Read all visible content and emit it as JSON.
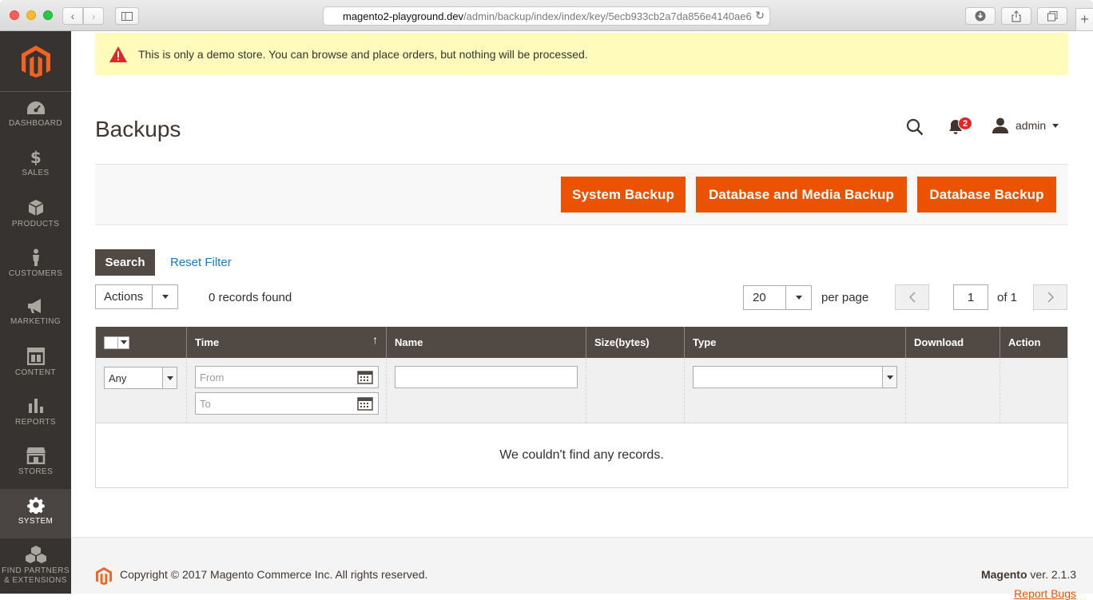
{
  "browser": {
    "url_domain": "magento2-playground.dev",
    "url_path": "/admin/backup/index/index/key/5ecb933cb2a7da856e4140ae6"
  },
  "sidebar": {
    "items": [
      {
        "label": "DASHBOARD",
        "icon": "dashboard-icon"
      },
      {
        "label": "SALES",
        "icon": "dollar-icon"
      },
      {
        "label": "PRODUCTS",
        "icon": "box-icon"
      },
      {
        "label": "CUSTOMERS",
        "icon": "person-icon"
      },
      {
        "label": "MARKETING",
        "icon": "megaphone-icon"
      },
      {
        "label": "CONTENT",
        "icon": "layout-icon"
      },
      {
        "label": "REPORTS",
        "icon": "bar-chart-icon"
      },
      {
        "label": "STORES",
        "icon": "storefront-icon"
      },
      {
        "label": "SYSTEM",
        "icon": "gear-icon"
      },
      {
        "label1": "FIND PARTNERS",
        "label2": "& EXTENSIONS",
        "icon": "cubes-icon"
      }
    ]
  },
  "demo_notice": "This is only a demo store. You can browse and place orders, but nothing will be processed.",
  "page_title": "Backups",
  "header": {
    "notification_count": "2",
    "user": "admin"
  },
  "buttons": {
    "system_backup": "System Backup",
    "db_media_backup": "Database and Media Backup",
    "db_backup": "Database Backup",
    "search": "Search",
    "reset_filter": "Reset Filter"
  },
  "toolbar": {
    "actions": "Actions",
    "records_found": "0 records found",
    "per_page_value": "20",
    "per_page_label": "per page",
    "page": "1",
    "of_pages": "of 1"
  },
  "grid": {
    "columns": [
      "Time",
      "Name",
      "Size(bytes)",
      "Type",
      "Download",
      "Action"
    ],
    "sort_indicator": "↑",
    "filter_any": "Any",
    "filter_from": "From",
    "filter_to": "To",
    "empty_message": "We couldn't find any records."
  },
  "footer": {
    "copyright": "Copyright © 2017 Magento Commerce Inc. All rights reserved.",
    "brand": "Magento",
    "version": " ver. 2.1.3",
    "report_bugs": "Report Bugs"
  },
  "colors": {
    "accent": "#eb5202",
    "sidebar": "#373330",
    "grid_header": "#514943",
    "notice": "#fffbbb"
  }
}
